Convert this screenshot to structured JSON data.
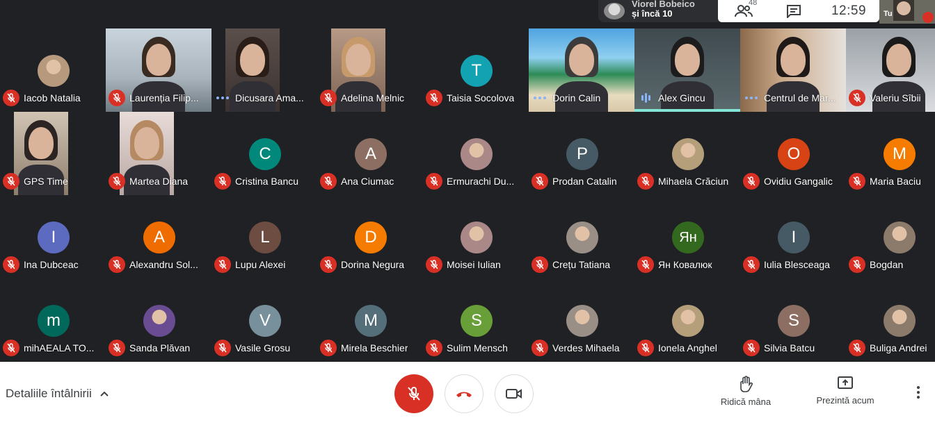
{
  "top_bar": {
    "presenter_name": "Viorel Bobeico",
    "presenter_more": "și încă 10",
    "people_count": "48",
    "clock": "12:59",
    "self_label": "Tu"
  },
  "participants": [
    {
      "name": "Iacob Natalia",
      "status": "muted",
      "avatar": "photo"
    },
    {
      "name": "Laurenția Filip...",
      "status": "muted",
      "avatar": "video"
    },
    {
      "name": "Dicusara Ama...",
      "status": "dots",
      "avatar": "video"
    },
    {
      "name": "Adelina Melnic",
      "status": "muted",
      "avatar": "video"
    },
    {
      "name": "Taisia Socolova",
      "status": "muted",
      "avatar": "letter",
      "letter": "T",
      "color": "#12a2b1"
    },
    {
      "name": "Dorin Calin",
      "status": "dots",
      "avatar": "video"
    },
    {
      "name": "Alex Gincu",
      "status": "speaking",
      "avatar": "video"
    },
    {
      "name": "Centrul de Mar...",
      "status": "dots",
      "avatar": "video"
    },
    {
      "name": "Valeriu Sîbii",
      "status": "muted",
      "avatar": "video"
    },
    {
      "name": "GPS Time",
      "status": "muted",
      "avatar": "video"
    },
    {
      "name": "Martea Diana",
      "status": "muted",
      "avatar": "video"
    },
    {
      "name": "Cristina Bancu",
      "status": "muted",
      "avatar": "letter",
      "letter": "C",
      "color": "#00897b"
    },
    {
      "name": "Ana Ciumac",
      "status": "muted",
      "avatar": "letter",
      "letter": "A",
      "color": "#8d6e63"
    },
    {
      "name": "Ermurachi Du...",
      "status": "muted",
      "avatar": "photo"
    },
    {
      "name": "Prodan Catalin",
      "status": "muted",
      "avatar": "letter",
      "letter": "P",
      "color": "#455a64"
    },
    {
      "name": "Mihaela Crăciun",
      "status": "muted",
      "avatar": "photo"
    },
    {
      "name": "Ovidiu Gangalic",
      "status": "muted",
      "avatar": "letter",
      "letter": "O",
      "color": "#d84315"
    },
    {
      "name": "Maria Baciu",
      "status": "muted",
      "avatar": "letter",
      "letter": "M",
      "color": "#f57c00"
    },
    {
      "name": "Ina Dubceac",
      "status": "muted",
      "avatar": "letter",
      "letter": "I",
      "color": "#5c6bc0"
    },
    {
      "name": "Alexandru Sol...",
      "status": "muted",
      "avatar": "letter",
      "letter": "A",
      "color": "#ef6c00"
    },
    {
      "name": "Lupu Alexei",
      "status": "muted",
      "avatar": "letter",
      "letter": "L",
      "color": "#6d4c41"
    },
    {
      "name": "Dorina Negura",
      "status": "muted",
      "avatar": "letter",
      "letter": "D",
      "color": "#f57c00"
    },
    {
      "name": "Moisei Iulian",
      "status": "muted",
      "avatar": "photo"
    },
    {
      "name": "Crețu Tatiana",
      "status": "muted",
      "avatar": "photo"
    },
    {
      "name": "Ян Ковалюк",
      "status": "muted",
      "avatar": "letter",
      "letter": "Ян",
      "color": "#33691e"
    },
    {
      "name": "Iulia Blesceaga",
      "status": "muted",
      "avatar": "letter",
      "letter": "I",
      "color": "#455a64"
    },
    {
      "name": "Bogdan",
      "status": "muted",
      "avatar": "photo"
    },
    {
      "name": "mihAEALA TO...",
      "status": "muted",
      "avatar": "letter",
      "letter": "m",
      "color": "#00695c"
    },
    {
      "name": "Sanda Plăvan",
      "status": "muted",
      "avatar": "photo"
    },
    {
      "name": "Vasile Grosu",
      "status": "muted",
      "avatar": "letter",
      "letter": "V",
      "color": "#78909c"
    },
    {
      "name": "Mirela Beschier",
      "status": "muted",
      "avatar": "letter",
      "letter": "M",
      "color": "#546e7a"
    },
    {
      "name": "Sulim Mensch",
      "status": "muted",
      "avatar": "letter",
      "letter": "S",
      "color": "#689f38"
    },
    {
      "name": "Verdes Mihaela",
      "status": "muted",
      "avatar": "photo"
    },
    {
      "name": "Ionela Anghel",
      "status": "muted",
      "avatar": "photo"
    },
    {
      "name": "Silvia Batcu",
      "status": "muted",
      "avatar": "letter",
      "letter": "S",
      "color": "#8d6e63"
    },
    {
      "name": "Buliga Andrei",
      "status": "muted",
      "avatar": "photo"
    }
  ],
  "bottom_bar": {
    "meeting_details": "Detaliile întâlnirii",
    "raise_hand": "Ridică mâna",
    "present_now": "Prezintă acum"
  },
  "colors": {
    "background": "#202124",
    "muted_red": "#d93025",
    "accent_blue": "#8ab4f8",
    "speaking_bar": "#81e6d6"
  }
}
